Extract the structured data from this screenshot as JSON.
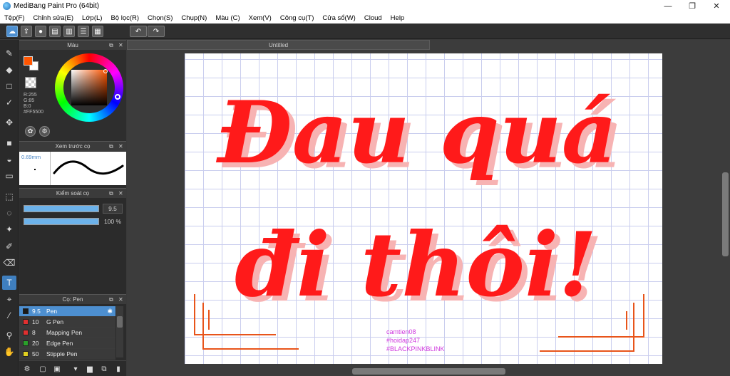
{
  "window": {
    "title": "MediBang Paint Pro (64bit)",
    "minimize": "—",
    "maximize": "❐",
    "close": "✕"
  },
  "menu": [
    "Tệp(F)",
    "Chỉnh sửa(E)",
    "Lớp(L)",
    "Bộ lọc(R)",
    "Chọn(S)",
    "Chụp(N)",
    "Màu (C)",
    "Xem(V)",
    "Công cụ(T)",
    "Cửa sổ(W)",
    "Cloud",
    "Help"
  ],
  "panels": {
    "color": {
      "title": "Màu",
      "r": "R:255",
      "g": "G:85",
      "b": "B:0",
      "hex": "#FF5500",
      "foreground": "#ff5500",
      "background": "#ffffff"
    },
    "brush_preview": {
      "title": "Xem trước cọ",
      "size": "0.69mm"
    },
    "brush_control": {
      "title": "Kiểm soát cọ",
      "size_value": "9.5",
      "size_fill": 1.0,
      "opacity_value": "100 %",
      "opacity_fill": 1.0
    },
    "brush_list": {
      "title": "Cọ: Pen",
      "items": [
        {
          "num": "9.5",
          "name": "Pen",
          "color": "#1a1a1a",
          "selected": true
        },
        {
          "num": "10",
          "name": "G Pen",
          "color": "#e03030",
          "selected": false
        },
        {
          "num": "8",
          "name": "Mapping Pen",
          "color": "#e03030",
          "selected": false
        },
        {
          "num": "20",
          "name": "Edge Pen",
          "color": "#2aa02a",
          "selected": false
        },
        {
          "num": "50",
          "name": "Stipple Pen",
          "color": "#e0d020",
          "selected": false
        }
      ]
    }
  },
  "document": {
    "tab": "Untitled",
    "line1": "Đau quá",
    "line2": "đi thôi!",
    "tags": [
      "camtien08",
      "#hoidap247",
      "#BLACKPINKBLINK"
    ],
    "ink_color": "#ff1a1a",
    "tag_color": "#d03adf"
  }
}
